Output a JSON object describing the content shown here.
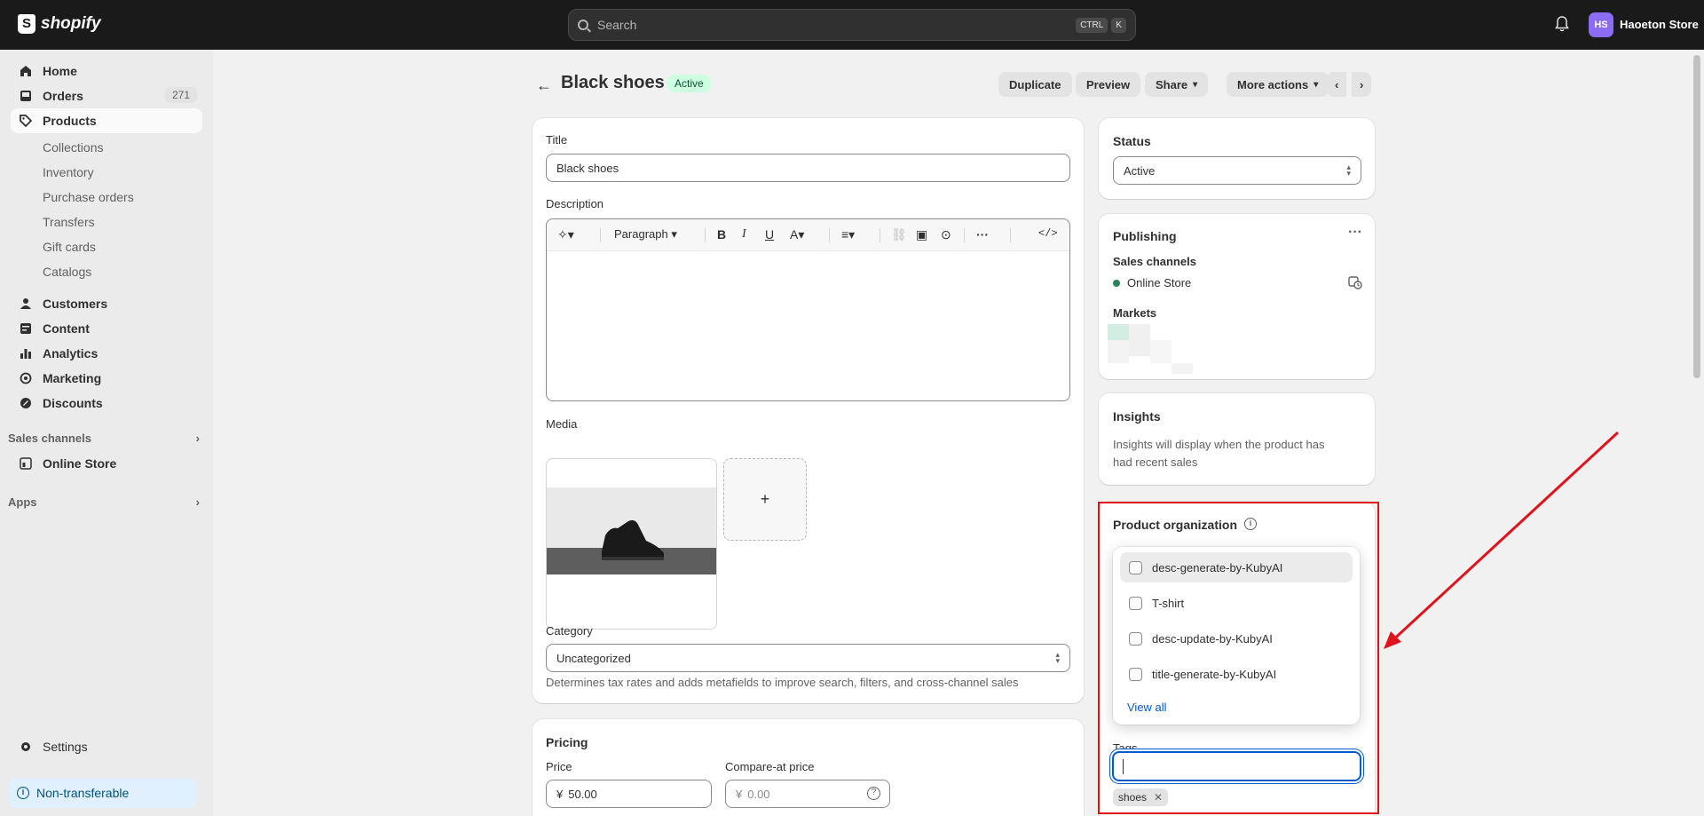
{
  "topbar": {
    "logo_text": "shopify",
    "search_placeholder": "Search",
    "shortcut_ctrl": "CTRL",
    "shortcut_key": "K",
    "avatar_initials": "HS",
    "store_name": "Haoeton Store"
  },
  "sidebar": {
    "home": "Home",
    "orders": "Orders",
    "orders_count": "271",
    "products": "Products",
    "products_sub": [
      "Collections",
      "Inventory",
      "Purchase orders",
      "Transfers",
      "Gift cards",
      "Catalogs"
    ],
    "customers": "Customers",
    "content": "Content",
    "analytics": "Analytics",
    "marketing": "Marketing",
    "discounts": "Discounts",
    "sales_channels": "Sales channels",
    "online_store": "Online Store",
    "apps": "Apps",
    "settings": "Settings",
    "non_transferable": "Non-transferable"
  },
  "header": {
    "title": "Black shoes",
    "status": "Active",
    "duplicate": "Duplicate",
    "preview": "Preview",
    "share": "Share",
    "more_actions": "More actions"
  },
  "main": {
    "title_label": "Title",
    "title_value": "Black shoes",
    "description_label": "Description",
    "paragraph": "Paragraph",
    "media_label": "Media",
    "media_add": "+",
    "category_label": "Category",
    "category_value": "Uncategorized",
    "category_help": "Determines tax rates and adds metafields to improve search, filters, and cross-channel sales",
    "pricing_title": "Pricing",
    "price_label": "Price",
    "price_currency": "¥",
    "price_value": "50.00",
    "compare_label": "Compare-at price",
    "compare_currency": "¥",
    "compare_placeholder": "0.00"
  },
  "right": {
    "status_title": "Status",
    "status_value": "Active",
    "publishing_title": "Publishing",
    "sales_channels": "Sales channels",
    "online_store": "Online Store",
    "markets": "Markets",
    "insights_title": "Insights",
    "insights_text_1": "Insights will display when the product has",
    "insights_text_2": "had recent sales",
    "org_title": "Product organization",
    "tag_options": [
      "desc-generate-by-KubyAI",
      "T-shirt",
      "desc-update-by-KubyAI",
      "title-generate-by-KubyAI"
    ],
    "view_all": "View all",
    "tags_label": "Tags",
    "tag_chip": "shoes"
  },
  "colors": {
    "accent": "#005bd3",
    "annotation_red": "#e0121b",
    "active_green": "#29845a"
  }
}
